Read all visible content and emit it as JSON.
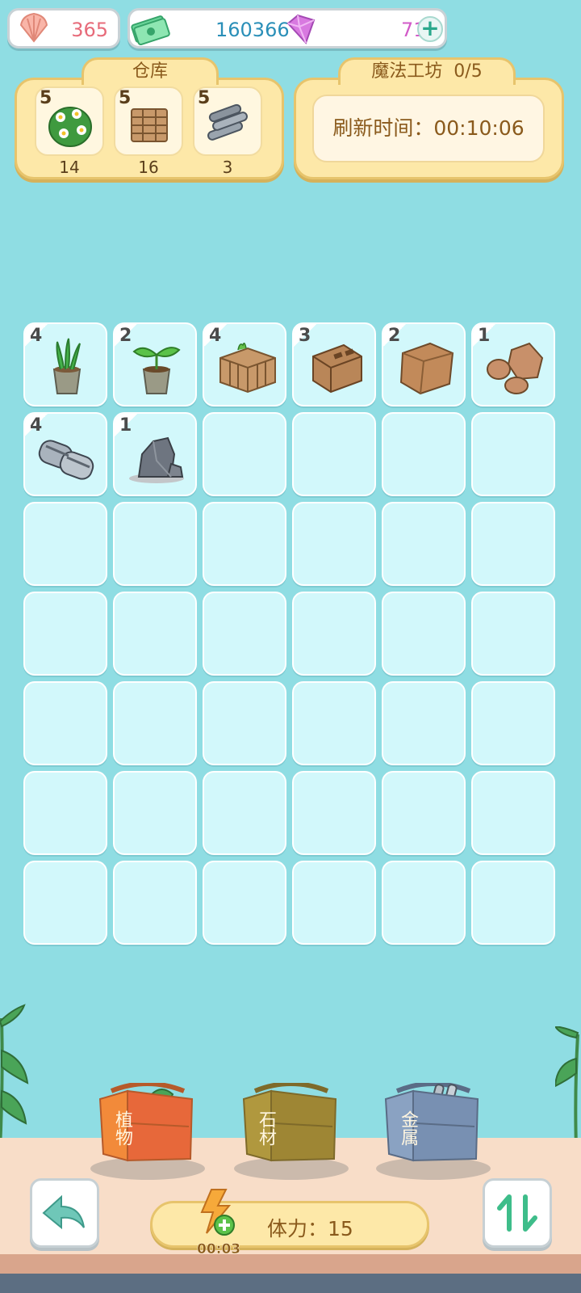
{
  "currency": {
    "shells": "365",
    "money": "160366",
    "gems": "71",
    "icons": [
      "shell-icon",
      "cash-icon",
      "gem-icon",
      "plus-icon"
    ]
  },
  "warehouse": {
    "title": "仓库",
    "items": [
      {
        "name": "flower-bush",
        "level": "5",
        "count": "14"
      },
      {
        "name": "brick-stack",
        "level": "5",
        "count": "16"
      },
      {
        "name": "metal-pipes",
        "level": "5",
        "count": "3"
      }
    ]
  },
  "workshop": {
    "title": "魔法工坊",
    "capacity": "0/5",
    "refresh_text": "刷新时间：00:10:06"
  },
  "grid": {
    "items": [
      {
        "icon": "grass-pot",
        "level": "4"
      },
      {
        "icon": "sprout-pot",
        "level": "2"
      },
      {
        "icon": "brick-bundle",
        "level": "4"
      },
      {
        "icon": "brick-block",
        "level": "3"
      },
      {
        "icon": "stone-block",
        "level": "2"
      },
      {
        "icon": "rocks",
        "level": "1"
      },
      {
        "icon": "metal-coils",
        "level": "4"
      },
      {
        "icon": "grey-rock",
        "level": "1"
      }
    ]
  },
  "crates": {
    "plant": "植物",
    "stone": "石材",
    "metal": "金属"
  },
  "stamina": {
    "label": "体力：15",
    "timer": "00:03"
  },
  "colors": {
    "background": "#8fdde3",
    "panel": "#fde8a8",
    "cell": "#d2f8fb",
    "money_text": "#2a8fb8",
    "gem_text": "#d25ac8",
    "shell_text": "#e76b7a"
  }
}
